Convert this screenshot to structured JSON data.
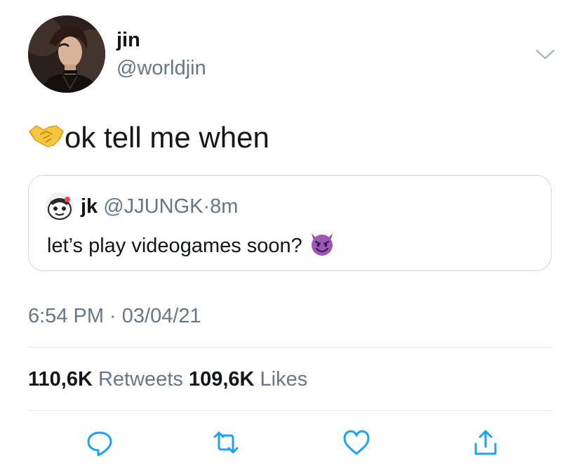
{
  "author": {
    "display_name": "jin",
    "handle": "@worldjin",
    "avatar": "avatar-photo"
  },
  "tweet": {
    "emoji": "handshake-emoji",
    "text": "ok tell me when"
  },
  "quoted_tweet": {
    "display_name": "jk",
    "handle": "@JJUNGK",
    "separator": "·",
    "time": "8m",
    "text": "let’s play videogames soon?",
    "emoji": "smiling-devil-emoji"
  },
  "meta": {
    "timestamp": "6:54 PM · 03/04/21"
  },
  "stats": {
    "retweets_count": "110,6K",
    "retweets_label": "Retweets",
    "likes_count": "109,6K",
    "likes_label": "Likes"
  },
  "actions": [
    "reply-icon",
    "retweet-icon",
    "like-icon",
    "share-icon"
  ],
  "colors": {
    "primary_text": "#14171a",
    "secondary_text": "#657786",
    "border": "#ccd6dd",
    "divider": "#e1e8ed",
    "icon": "#1da1f2"
  }
}
